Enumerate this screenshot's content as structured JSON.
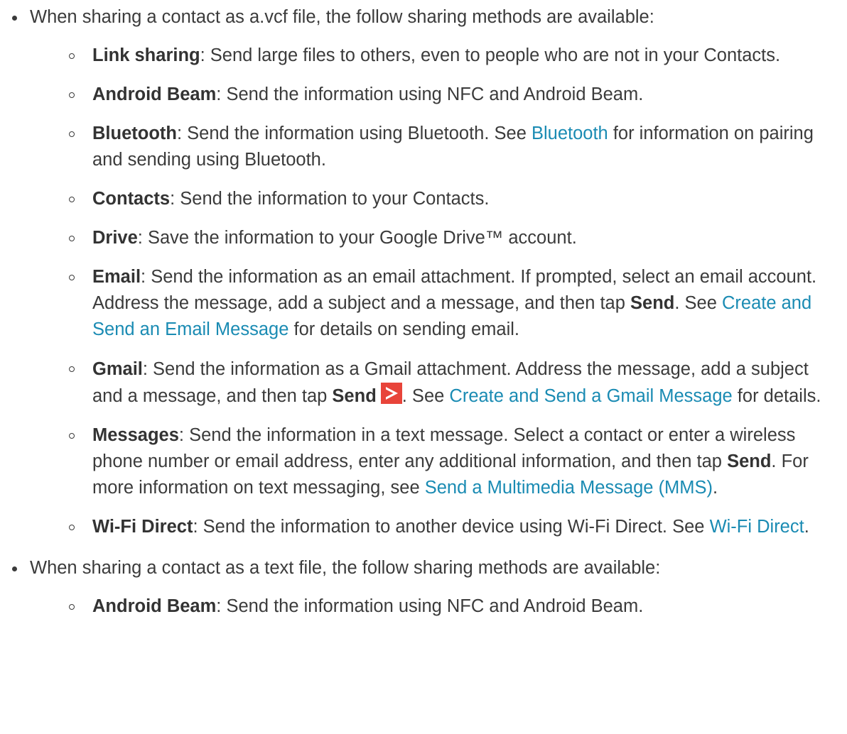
{
  "sections": [
    {
      "intro": "When sharing a contact as a.vcf file, the follow sharing methods are available:",
      "items": {
        "link_sharing": {
          "term": "Link sharing",
          "text": ": Send large files to others, even to people who are not in your Contacts."
        },
        "android_beam": {
          "term": "Android Beam",
          "text": ": Send the information using NFC and Android Beam."
        },
        "bluetooth": {
          "term": "Bluetooth",
          "text_a": ": Send the information using Bluetooth. See ",
          "link": "Bluetooth",
          "text_b": " for information on pairing and sending using Bluetooth."
        },
        "contacts": {
          "term": "Contacts",
          "text": ": Send the information to your Contacts."
        },
        "drive": {
          "term": "Drive",
          "text": ": Save the information to your Google Drive™ account."
        },
        "email": {
          "term": "Email",
          "text_a": ": Send the information as an email attachment. If prompted, select an email account. Address the message, add a subject and a message, and then tap ",
          "send": "Send",
          "text_b": ". See ",
          "link": "Create and Send an Email Message",
          "text_c": " for details on sending email."
        },
        "gmail": {
          "term": "Gmail",
          "text_a": ": Send the information as a Gmail attachment. Address the message, add a subject and a message, and then tap ",
          "send": "Send",
          "icon": "send-arrow-icon",
          "text_b": ". See ",
          "link": "Create and Send a Gmail Message",
          "text_c": " for details."
        },
        "messages": {
          "term": "Messages",
          "text_a": ": Send the information in a text message. Select a contact or enter a wireless phone number or email address, enter any additional information, and then tap ",
          "send": "Send",
          "text_b": ". For more information on text messaging, see ",
          "link": "Send a Multimedia Message (MMS)",
          "text_c": "."
        },
        "wifi_direct": {
          "term": "Wi-Fi Direct",
          "text_a": ": Send the information to another device using Wi-Fi Direct. See ",
          "link": "Wi-Fi Direct",
          "text_b": "."
        }
      }
    },
    {
      "intro": "When sharing a contact as a text file, the follow sharing methods are available:",
      "items": {
        "android_beam": {
          "term": "Android Beam",
          "text": ": Send the information using NFC and Android Beam."
        }
      }
    }
  ],
  "colors": {
    "text": "#3b3b3b",
    "link": "#1a8bb3",
    "send_icon": "#e8443a"
  }
}
